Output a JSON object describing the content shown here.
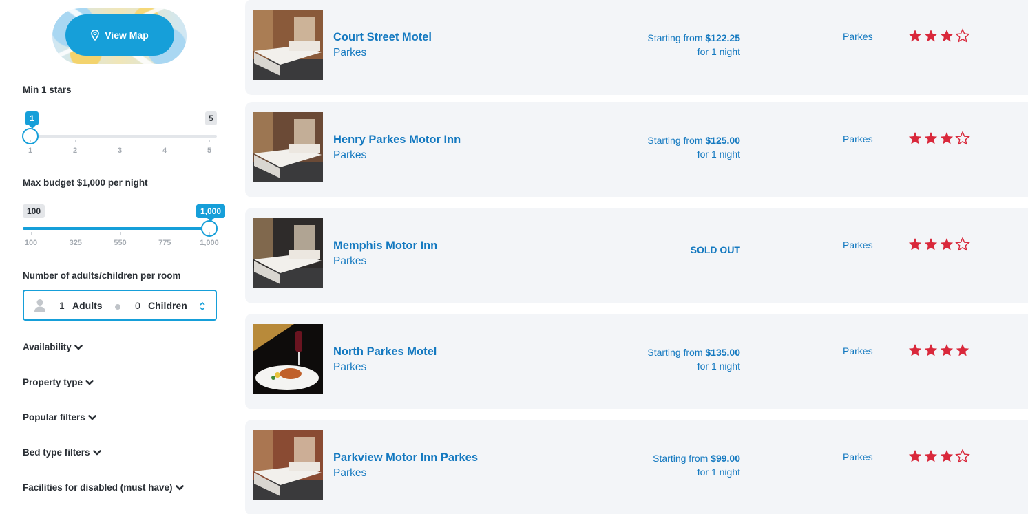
{
  "sidebar": {
    "view_map_label": "View Map",
    "min_stars": {
      "label": "Min 1 stars",
      "value": 1,
      "min": 1,
      "max": 5,
      "value_badge": "1",
      "max_badge": "5",
      "ticks": [
        "1",
        "2",
        "3",
        "4",
        "5"
      ]
    },
    "budget": {
      "label_prefix": "Max budget ",
      "label_amount": "$1,000",
      "label_suffix": " per night",
      "min": 100,
      "max": 1000,
      "low_value": 100,
      "high_value": 1000,
      "min_badge": "100",
      "value_badge": "1,000",
      "ticks": [
        "100",
        "325",
        "550",
        "775",
        "1,000"
      ]
    },
    "guests": {
      "label": "Number of adults/children per room",
      "adults_count": "1",
      "adults_label": "Adults",
      "children_count": "0",
      "children_label": "Children"
    },
    "filters": [
      "Availability",
      "Property type",
      "Popular filters",
      "Bed type filters",
      "Facilities for disabled (must have)"
    ]
  },
  "results": [
    {
      "name": "Court Street Motel",
      "city": "Parkes",
      "price_prefix": "Starting from ",
      "price": "$122.25",
      "nights": "for 1 night",
      "location": "Parkes",
      "rating": 3,
      "photo": "motel-room"
    },
    {
      "name": "Henry Parkes Motor Inn",
      "city": "Parkes",
      "price_prefix": "Starting from ",
      "price": "$125.00",
      "nights": "for 1 night",
      "location": "Parkes",
      "rating": 3,
      "photo": "motel-room"
    },
    {
      "name": "Memphis Motor Inn",
      "city": "Parkes",
      "status": "SOLD OUT",
      "location": "Parkes",
      "rating": 3,
      "photo": "motel-room"
    },
    {
      "name": "North Parkes Motel",
      "city": "Parkes",
      "price_prefix": "Starting from ",
      "price": "$135.00",
      "nights": "for 1 night",
      "location": "Parkes",
      "rating": 4,
      "photo": "restaurant-dish"
    },
    {
      "name": "Parkview Motor Inn Parkes",
      "city": "Parkes",
      "price_prefix": "Starting from ",
      "price": "$99.00",
      "nights": "for 1 night",
      "location": "Parkes",
      "rating": 3,
      "photo": "motel-room"
    }
  ],
  "colors": {
    "accent": "#169fd9",
    "link": "#1479c0",
    "star": "#d9283b",
    "card_bg": "#f3f5f8"
  }
}
